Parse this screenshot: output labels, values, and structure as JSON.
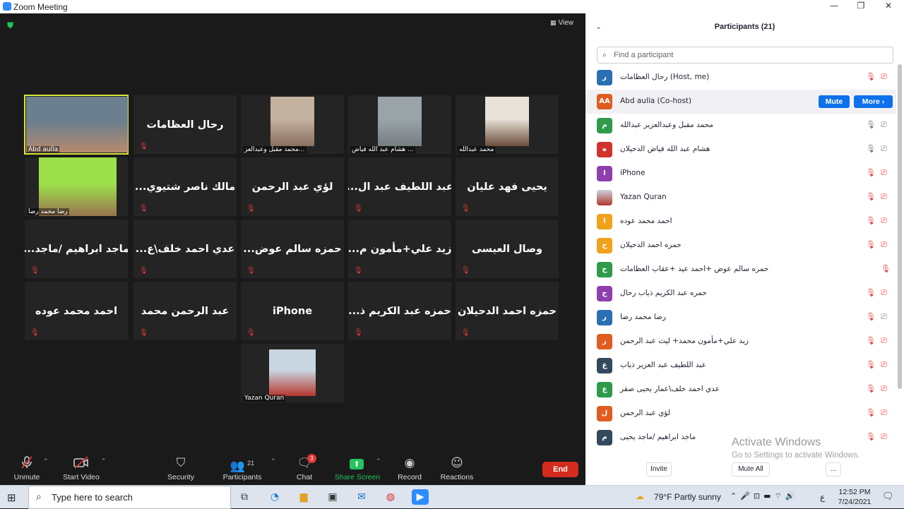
{
  "window": {
    "title": "Zoom Meeting",
    "min": "—",
    "max": "❐",
    "close": "✕"
  },
  "video": {
    "view_label": "View",
    "tiles": [
      {
        "type": "video",
        "label": "Abd aulla",
        "active": true
      },
      {
        "type": "name",
        "name": "رحال العظامات"
      },
      {
        "type": "video",
        "label": "محمد مقبل وعبدالعز..."
      },
      {
        "type": "video",
        "label": "هشام عبد الله فياض ..."
      },
      {
        "type": "video",
        "label": "محمد عبدالله"
      },
      {
        "type": "video",
        "label": "رضا محمد رضا"
      },
      {
        "type": "name",
        "name": "مالك ناصر شتيوي..."
      },
      {
        "type": "name",
        "name": "لؤي عبد الرحمن"
      },
      {
        "type": "name",
        "name": "عبد اللطيف عبد ال..."
      },
      {
        "type": "name",
        "name": "يحيى فهد عليان"
      },
      {
        "type": "name",
        "name": "ماجد ابراهيم /ماجد..."
      },
      {
        "type": "name",
        "name": "عدي احمد خلف\\ع..."
      },
      {
        "type": "name",
        "name": "حمزه سالم عوض..."
      },
      {
        "type": "name",
        "name": "زيد علي+مأمون م..."
      },
      {
        "type": "name",
        "name": "وصال العيسى"
      },
      {
        "type": "name",
        "name": "احمد محمد عوده"
      },
      {
        "type": "name",
        "name": "عبد الرحمن محمد"
      },
      {
        "type": "name",
        "name": "iPhone"
      },
      {
        "type": "name",
        "name": "حمزه عبد الكريم ذ..."
      },
      {
        "type": "name",
        "name": "حمزه احمد الدحيلان"
      },
      {
        "type": "video",
        "label": "Yazan Quran"
      }
    ]
  },
  "toolbar": {
    "unmute": "Unmute",
    "start_video": "Start Video",
    "security": "Security",
    "participants": "Participants",
    "participants_count": "21",
    "chat": "Chat",
    "chat_badge": "3",
    "share_screen": "Share Screen",
    "record": "Record",
    "reactions": "Reactions",
    "end": "End"
  },
  "panel": {
    "title": "Participants (21)",
    "search_placeholder": "Find a participant",
    "mute_btn": "Mute",
    "more_btn": "More ›",
    "participants": [
      {
        "initial": "ر",
        "color": "#2a6fb5",
        "name": "رحال العظامات (Host, me)",
        "mic": "muted",
        "cam": "off"
      },
      {
        "initial": "AA",
        "color": "#e05d1f",
        "name": "Abd aulla (Co-host)",
        "mic": "none",
        "cam": "none",
        "highlight": true
      },
      {
        "initial": "م",
        "color": "#2e9b4a",
        "name": "محمد مقبل وعبدالعزير عبدالله",
        "mic": "on",
        "cam": "on"
      },
      {
        "initial": "ه",
        "color": "#d2322d",
        "name": "هشام عبد الله فياض الدحيلان",
        "mic": "on",
        "cam": "on"
      },
      {
        "initial": "I",
        "color": "#8e3fae",
        "name": "iPhone",
        "mic": "muted",
        "cam": "off"
      },
      {
        "initial": "",
        "color": "#7a4b3a",
        "name": "Yazan Quran",
        "mic": "muted",
        "cam": "off",
        "photo": true
      },
      {
        "initial": "ا",
        "color": "#f0a21b",
        "name": "احمد محمد عوده",
        "mic": "muted",
        "cam": "off"
      },
      {
        "initial": "ح",
        "color": "#f0a21b",
        "name": "حمره احمد الدحيلان",
        "mic": "muted",
        "cam": "off"
      },
      {
        "initial": "ح",
        "color": "#2e9b4a",
        "name": "حمره سالم عوض +احمد عيد +عقاب العظامات",
        "mic": "muted",
        "cam": "none"
      },
      {
        "initial": "ح",
        "color": "#8e3fae",
        "name": "حمره عبد الكريم ذياب رحال",
        "mic": "muted",
        "cam": "off"
      },
      {
        "initial": "ر",
        "color": "#2a6fb5",
        "name": "رضا محمد رضا",
        "mic": "muted",
        "cam": "on"
      },
      {
        "initial": "ز",
        "color": "#e05d1f",
        "name": "زيد علي+مأمون محمد+ ليث عبد الرحمن",
        "mic": "muted",
        "cam": "off"
      },
      {
        "initial": "ع",
        "color": "#35495e",
        "name": "عبد اللطيف عبد العزير ذياب",
        "mic": "muted",
        "cam": "off"
      },
      {
        "initial": "ع",
        "color": "#2e9b4a",
        "name": "عدي احمد خلف\\عمار يحيى صقر",
        "mic": "muted",
        "cam": "off"
      },
      {
        "initial": "ل",
        "color": "#e05d1f",
        "name": "لؤي عبد الرحمن",
        "mic": "muted",
        "cam": "off"
      },
      {
        "initial": "م",
        "color": "#35495e",
        "name": "ماجد ابراهيم /ماجد يحيى",
        "mic": "muted",
        "cam": "off"
      }
    ],
    "activate_line1": "Activate Windows",
    "activate_line2": "Go to Settings to activate Windows.",
    "invite": "Invite",
    "mute_all": "Mute All",
    "more": "..."
  },
  "taskbar": {
    "search_placeholder": "Type here to search",
    "weather": "79°F  Partly sunny",
    "lang": "ع",
    "time": "12:52 PM",
    "date": "7/24/2021"
  }
}
